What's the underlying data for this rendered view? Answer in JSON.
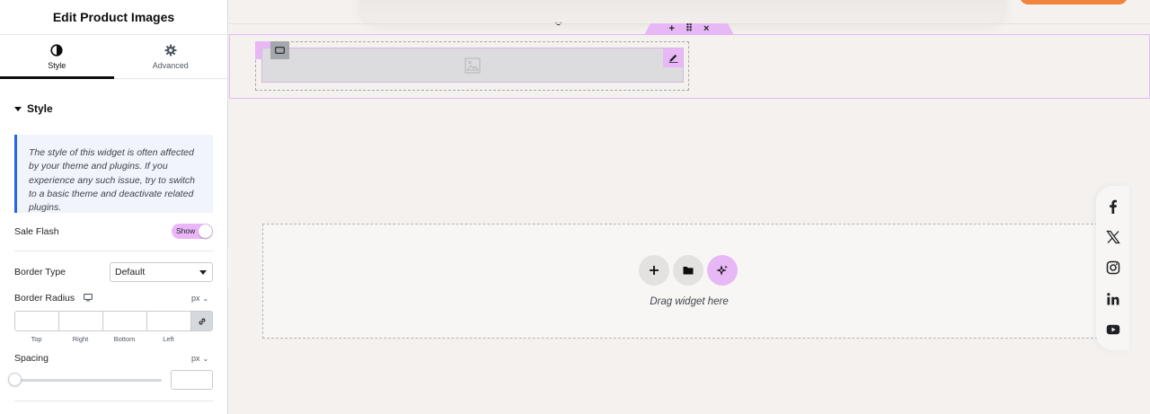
{
  "panel": {
    "title": "Edit Product Images",
    "tabs": [
      {
        "label": "Style",
        "icon": "half-circle-icon",
        "active": true
      },
      {
        "label": "Advanced",
        "icon": "gear-icon",
        "active": false
      }
    ],
    "section_title": "Style",
    "notice": "The style of this widget is often affected by your theme and plugins. If you experience any such issue, try to switch to a basic theme and deactivate related plugins.",
    "sale_flash": {
      "label": "Sale Flash",
      "toggle": "Show"
    },
    "border_type": {
      "label": "Border Type",
      "value": "Default"
    },
    "border_radius": {
      "label": "Border Radius",
      "unit": "px",
      "fields": [
        "Top",
        "Right",
        "Bottom",
        "Left"
      ]
    },
    "spacing": {
      "label": "Spacing",
      "unit": "px",
      "value": 0
    }
  },
  "canvas": {
    "drop_text": "Drag widget here"
  },
  "colors": {
    "accent_pink": "#e7b8f5",
    "notice_border": "#2563eb",
    "orange_button": "#f0843c"
  },
  "social_icons": [
    "facebook-icon",
    "x-twitter-icon",
    "instagram-icon",
    "linkedin-icon",
    "youtube-icon"
  ]
}
